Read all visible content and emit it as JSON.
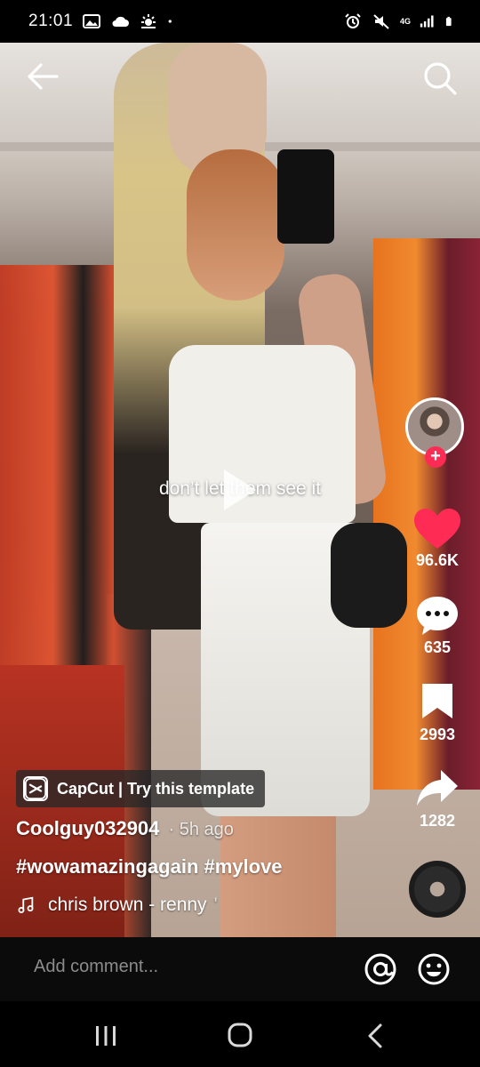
{
  "status_bar": {
    "time": "21:01",
    "network_label": "4G"
  },
  "video": {
    "overlay_text": "don’t let them see it"
  },
  "actions": {
    "likes": "96.6K",
    "comments": "635",
    "saves": "2993",
    "shares": "1282"
  },
  "template": {
    "label": "CapCut | Try this template"
  },
  "post": {
    "author": "Coolguy032904",
    "time": "· 5h ago",
    "caption": "#wowamazingagain #mylove",
    "sound": "chris brown - renny",
    "sound_tail": "'"
  },
  "comment_bar": {
    "placeholder": "Add comment..."
  },
  "colors": {
    "like_red": "#fe2c55",
    "follow_red": "#fe2c55"
  },
  "icons": [
    "back-arrow-icon",
    "search-icon",
    "play-icon",
    "heart-icon",
    "comment-icon",
    "bookmark-icon",
    "share-icon",
    "capcut-icon",
    "music-note-icon",
    "at-icon",
    "emoji-icon",
    "recents-icon",
    "home-icon",
    "back-nav-icon"
  ]
}
